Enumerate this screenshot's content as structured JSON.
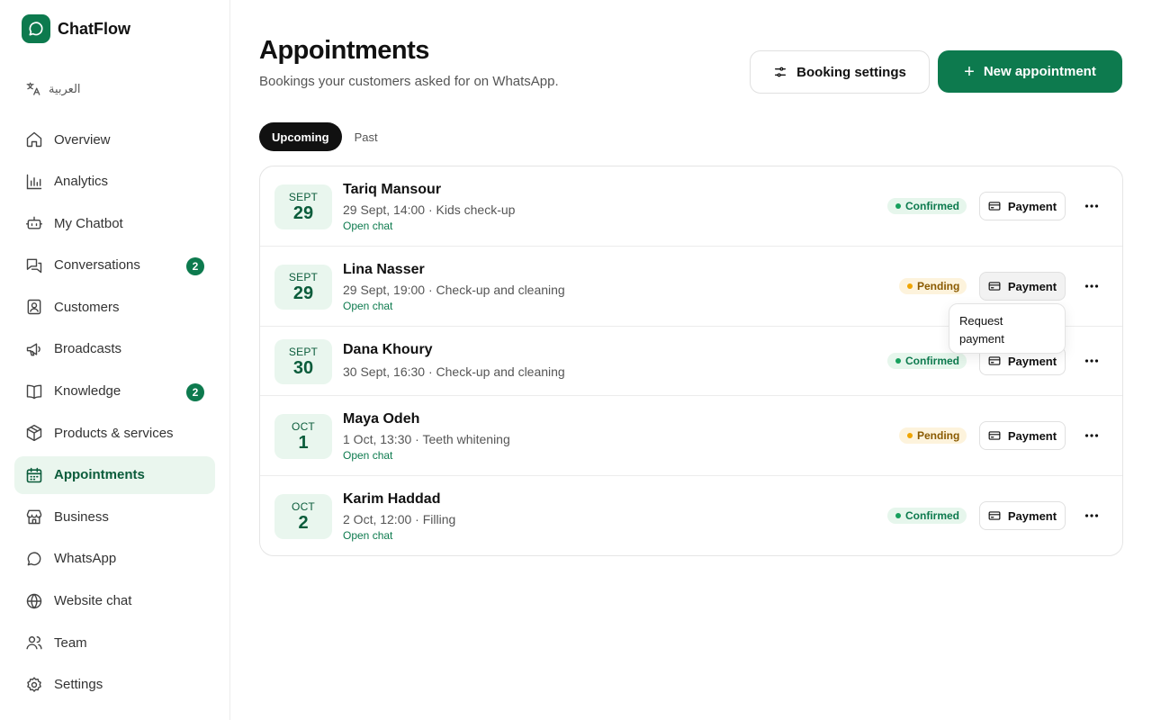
{
  "brand": {
    "name": "ChatFlow"
  },
  "sidebar": {
    "language_label": "العربية",
    "items": [
      {
        "label": "Overview",
        "icon": "home-icon"
      },
      {
        "label": "Analytics",
        "icon": "bar-chart-icon"
      },
      {
        "label": "My Chatbot",
        "icon": "bot-icon"
      },
      {
        "label": "Conversations",
        "icon": "chat-bubbles-icon",
        "badge": "2"
      },
      {
        "label": "Customers",
        "icon": "contact-card-icon"
      },
      {
        "label": "Broadcasts",
        "icon": "megaphone-icon"
      },
      {
        "label": "Knowledge",
        "icon": "book-icon",
        "badge": "2"
      },
      {
        "label": "Products & services",
        "icon": "box-icon"
      },
      {
        "label": "Appointments",
        "icon": "calendar-icon",
        "active": true
      },
      {
        "label": "Business",
        "icon": "store-icon"
      },
      {
        "label": "WhatsApp",
        "icon": "chat-bubble-icon"
      },
      {
        "label": "Website chat",
        "icon": "globe-icon"
      },
      {
        "label": "Team",
        "icon": "users-icon"
      },
      {
        "label": "Settings",
        "icon": "gear-icon"
      }
    ]
  },
  "header": {
    "title": "Appointments",
    "subtitle": "Bookings your customers asked for on WhatsApp.",
    "settings_button": "Booking settings",
    "new_button": "New appointment"
  },
  "tabs": [
    {
      "label": "Upcoming",
      "active": true
    },
    {
      "label": "Past",
      "active": false
    }
  ],
  "appointments": [
    {
      "month": "SEPT",
      "day": "29",
      "name": "Tariq Mansour",
      "detail": "29 Sept, 14:00 · Kids check-up",
      "link": "Open chat",
      "status": "Confirmed",
      "payment_label": "Payment"
    },
    {
      "month": "SEPT",
      "day": "29",
      "name": "Lina Nasser",
      "detail": "29 Sept, 19:00 · Check-up and cleaning",
      "link": "Open chat",
      "status": "Pending",
      "payment_label": "Payment"
    },
    {
      "month": "SEPT",
      "day": "30",
      "name": "Dana Khoury",
      "detail": "30 Sept, 16:30 · Check-up and cleaning",
      "link": "",
      "status": "Confirmed",
      "payment_label": "Payment"
    },
    {
      "month": "OCT",
      "day": "1",
      "name": "Maya Odeh",
      "detail": "1 Oct, 13:30 · Teeth whitening",
      "link": "Open chat",
      "status": "Pending",
      "payment_label": "Payment"
    },
    {
      "month": "OCT",
      "day": "2",
      "name": "Karim Haddad",
      "detail": "2 Oct, 12:00 · Filling",
      "link": "Open chat",
      "status": "Confirmed",
      "payment_label": "Payment"
    }
  ],
  "popover": {
    "line1": "Request",
    "line2": "payment"
  },
  "colors": {
    "brand": "#0d7a4e",
    "active_bg": "#eaf6ee",
    "confirmed": "#17a05d",
    "pending": "#f0a500"
  }
}
